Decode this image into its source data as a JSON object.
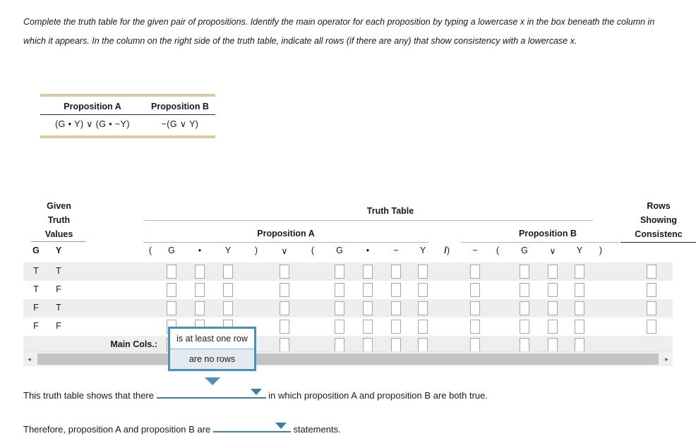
{
  "instructions": "Complete the truth table for the given pair of propositions. Identify the main operator for each proposition by typing a lowercase x in the box beneath the column in which it appears. In the column on the right side of the truth table, indicate all rows (if there are any) that show consistency with a lowercase x.",
  "propositions_table": {
    "headers": [
      "Proposition A",
      "Proposition B"
    ],
    "values": [
      "(G • Y) ∨ (G • ~Y)",
      "~(G ∨ Y)"
    ]
  },
  "truth_table": {
    "given_header": [
      "Given",
      "Truth",
      "Values"
    ],
    "title": "Truth Table",
    "proposition_a_label": "Proposition A",
    "proposition_b_label": "Proposition B",
    "rows_showing_header": [
      "Rows",
      "Showing",
      "Consistenc"
    ],
    "given_columns": [
      "G",
      "Y"
    ],
    "proposition_a_symbols": [
      "(",
      "G",
      "•",
      "Y",
      ")",
      "∨",
      "(",
      "G",
      "•",
      "~",
      "Y",
      ")"
    ],
    "separator_symbol": "/",
    "proposition_b_symbols": [
      "~",
      "(",
      "G",
      "∨",
      "Y",
      ")"
    ],
    "rows": [
      {
        "given": [
          "T",
          "T"
        ]
      },
      {
        "given": [
          "T",
          "F"
        ]
      },
      {
        "given": [
          "F",
          "T"
        ]
      },
      {
        "given": [
          "F",
          "F"
        ]
      }
    ],
    "main_cols_label": "Main Cols.:"
  },
  "dropdown_popup": {
    "options": [
      "is at least one row",
      "are no rows"
    ],
    "selected_index": 0
  },
  "sentence1": {
    "before": "This truth table shows that there",
    "value": "",
    "after": "in which proposition A and proposition B are both true."
  },
  "sentence2": {
    "before": "Therefore, proposition A and proposition B are",
    "value": "",
    "after": "statements."
  },
  "scrollbar": {
    "left_arrow": "◂",
    "right_arrow": "▸"
  },
  "colors": {
    "rule_tan": "#d8cba4",
    "row_shade": "#eeeeee",
    "accent_blue": "#4a90bd",
    "field_blue": "#3c7fae"
  }
}
